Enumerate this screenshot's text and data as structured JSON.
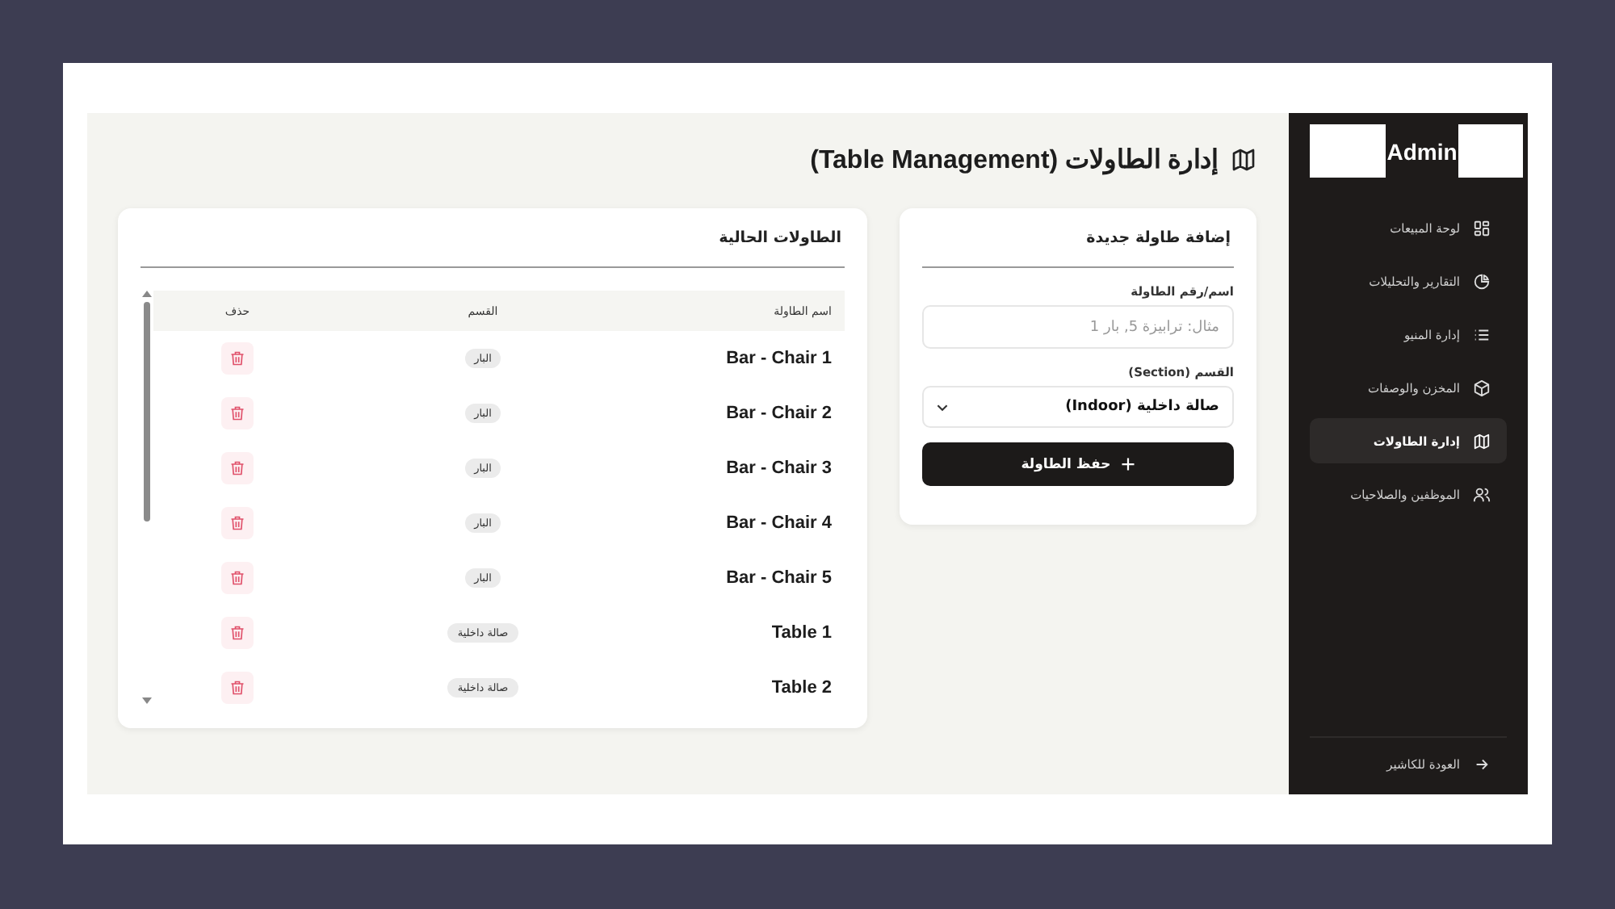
{
  "sidebar": {
    "brand": "Admin",
    "items": [
      {
        "label": "لوحة المبيعات",
        "kind": "grid",
        "selected": false
      },
      {
        "label": "التقارير والتحليلات",
        "kind": "pie",
        "selected": false
      },
      {
        "label": "إدارة المنيو",
        "kind": "list",
        "selected": false
      },
      {
        "label": "المخزن والوصفات",
        "kind": "box",
        "selected": false
      },
      {
        "label": "إدارة الطاولات",
        "kind": "map",
        "selected": true
      },
      {
        "label": "الموظفين والصلاحيات",
        "kind": "users",
        "selected": false
      }
    ],
    "back_link": "العودة للكاشير"
  },
  "page": {
    "title": "إدارة الطاولات (Table Management)"
  },
  "add_form": {
    "title": "إضافة طاولة جديدة",
    "name_label": "اسم/رقم الطاولة",
    "name_placeholder": "مثال: ترابيزة 5, بار 1",
    "section_label": "القسم (Section)",
    "section_value": "صالة داخلية (Indoor)",
    "submit": "حفظ الطاولة"
  },
  "tables_card": {
    "title": "الطاولات الحالية",
    "columns": [
      "اسم الطاولة",
      "القسم",
      "حذف"
    ],
    "rows": [
      {
        "name": "Bar - Chair 1",
        "section": "البار"
      },
      {
        "name": "Bar - Chair 2",
        "section": "البار"
      },
      {
        "name": "Bar - Chair 3",
        "section": "البار"
      },
      {
        "name": "Bar - Chair 4",
        "section": "البار"
      },
      {
        "name": "Bar - Chair 5",
        "section": "البار"
      },
      {
        "name": "Table 1",
        "section": "صالة داخلية"
      },
      {
        "name": "Table 2",
        "section": "صالة داخلية"
      }
    ]
  }
}
